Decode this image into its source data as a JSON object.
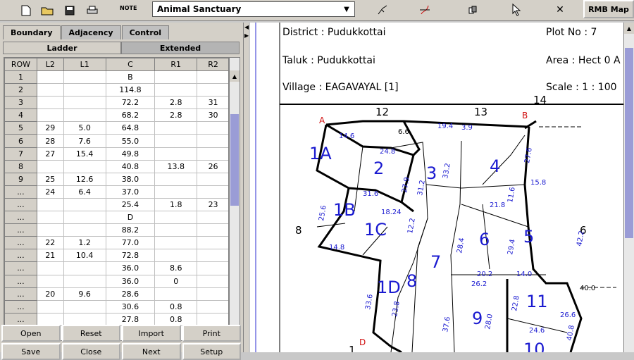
{
  "toolbar": {
    "note_label": "NOTE",
    "map_selector": "Animal Sanctuary",
    "rmb_map_label": "RMB Map"
  },
  "tabs": [
    "Boundary",
    "Adjacency",
    "Control"
  ],
  "subtabs": [
    "Ladder",
    "Extended"
  ],
  "grid": {
    "headers": [
      "ROW",
      "L2",
      "L1",
      "C",
      "R1",
      "R2"
    ],
    "rows": [
      [
        "1",
        "",
        "",
        "B",
        "",
        ""
      ],
      [
        "2",
        "",
        "",
        "114.8",
        "",
        ""
      ],
      [
        "3",
        "",
        "",
        "72.2",
        "2.8",
        "31"
      ],
      [
        "4",
        "",
        "",
        "68.2",
        "2.8",
        "30"
      ],
      [
        "5",
        "29",
        "5.0",
        "64.8",
        "",
        ""
      ],
      [
        "6",
        "28",
        "7.6",
        "55.0",
        "",
        ""
      ],
      [
        "7",
        "27",
        "15.4",
        "49.8",
        "",
        ""
      ],
      [
        "8",
        "",
        "",
        "40.8",
        "13.8",
        "26"
      ],
      [
        "9",
        "25",
        "12.6",
        "38.0",
        "",
        ""
      ],
      [
        "...",
        "24",
        "6.4",
        "37.0",
        "",
        ""
      ],
      [
        "...",
        "",
        "",
        "25.4",
        "1.8",
        "23"
      ],
      [
        "...",
        "",
        "",
        "D",
        "",
        ""
      ],
      [
        "...",
        "",
        "",
        "88.2",
        "",
        ""
      ],
      [
        "...",
        "22",
        "1.2",
        "77.0",
        "",
        ""
      ],
      [
        "...",
        "21",
        "10.4",
        "72.8",
        "",
        ""
      ],
      [
        "...",
        "",
        "",
        "36.0",
        "8.6",
        ""
      ],
      [
        "...",
        "",
        "",
        "36.0",
        "0",
        ""
      ],
      [
        "...",
        "20",
        "9.6",
        "28.6",
        "",
        ""
      ],
      [
        "...",
        "",
        "",
        "30.6",
        "0.8",
        ""
      ],
      [
        "...",
        "",
        "",
        "27.8",
        "0.8",
        ""
      ]
    ]
  },
  "buttons_row1": [
    "Open",
    "Reset",
    "Import",
    "Print"
  ],
  "buttons_row2": [
    "Save",
    "Close",
    "Next",
    "Setup"
  ],
  "map_info": {
    "district": "District : Pudukkottai",
    "plot_no": "Plot No : 7",
    "taluk": "Taluk : Pudukkottai",
    "area": "Area : Hect 0 A",
    "village": "Village : EAGAVAYAL [1]",
    "scale": "Scale : 1 : 100"
  },
  "map_labels": {
    "parcels": [
      "1A",
      "2",
      "3",
      "4",
      "1B",
      "1C",
      "6",
      "5",
      "7",
      "8",
      "1D",
      "9",
      "11",
      "10"
    ],
    "survey_numbers": [
      "12",
      "13",
      "14",
      "8",
      "6",
      "1"
    ],
    "corners": [
      "A",
      "B",
      "D"
    ],
    "measurements": [
      "14.6",
      "24.8",
      "27.9",
      "31.2",
      "33.2",
      "19.4",
      "21.8",
      "11.6",
      "15.8",
      "27.6",
      "14.8",
      "25.6",
      "31.6",
      "18.24",
      "42.2",
      "29.4",
      "28.4",
      "14.0",
      "20.2",
      "26.2",
      "22.8",
      "24.6",
      "40.8",
      "33.6",
      "23.8",
      "37.6",
      "40.0",
      "3.9",
      "6.6",
      "12.2",
      "28.0",
      "26.6"
    ]
  }
}
